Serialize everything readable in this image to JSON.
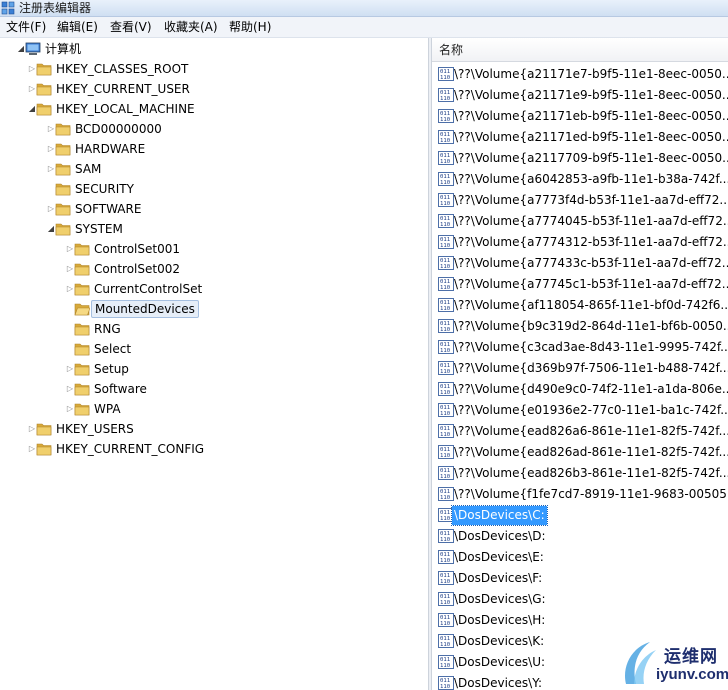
{
  "window": {
    "title": "注册表编辑器"
  },
  "menu": {
    "file": "文件(F)",
    "edit": "编辑(E)",
    "view": "查看(V)",
    "favorites": "收藏夹(A)",
    "help": "帮助(H)"
  },
  "tree": [
    {
      "label": "计算机",
      "level": 0,
      "state": "expanded",
      "icon": "computer-icon"
    },
    {
      "label": "HKEY_CLASSES_ROOT",
      "level": 1,
      "state": "collapsed",
      "icon": "folder-icon"
    },
    {
      "label": "HKEY_CURRENT_USER",
      "level": 1,
      "state": "collapsed",
      "icon": "folder-icon"
    },
    {
      "label": "HKEY_LOCAL_MACHINE",
      "level": 1,
      "state": "expanded",
      "icon": "folder-icon"
    },
    {
      "label": "BCD00000000",
      "level": 2,
      "state": "collapsed",
      "icon": "folder-icon"
    },
    {
      "label": "HARDWARE",
      "level": 2,
      "state": "collapsed",
      "icon": "folder-icon"
    },
    {
      "label": "SAM",
      "level": 2,
      "state": "collapsed",
      "icon": "folder-icon"
    },
    {
      "label": "SECURITY",
      "level": 2,
      "state": "leaf",
      "icon": "folder-icon"
    },
    {
      "label": "SOFTWARE",
      "level": 2,
      "state": "collapsed",
      "icon": "folder-icon"
    },
    {
      "label": "SYSTEM",
      "level": 2,
      "state": "expanded",
      "icon": "folder-icon"
    },
    {
      "label": "ControlSet001",
      "level": 3,
      "state": "collapsed",
      "icon": "folder-icon"
    },
    {
      "label": "ControlSet002",
      "level": 3,
      "state": "collapsed",
      "icon": "folder-icon"
    },
    {
      "label": "CurrentControlSet",
      "level": 3,
      "state": "collapsed",
      "icon": "folder-icon"
    },
    {
      "label": "MountedDevices",
      "level": 3,
      "state": "leaf",
      "icon": "folder-open-icon",
      "selected": true
    },
    {
      "label": "RNG",
      "level": 3,
      "state": "leaf",
      "icon": "folder-icon"
    },
    {
      "label": "Select",
      "level": 3,
      "state": "leaf",
      "icon": "folder-icon"
    },
    {
      "label": "Setup",
      "level": 3,
      "state": "collapsed",
      "icon": "folder-icon"
    },
    {
      "label": "Software",
      "level": 3,
      "state": "collapsed",
      "icon": "folder-icon"
    },
    {
      "label": "WPA",
      "level": 3,
      "state": "collapsed",
      "icon": "folder-icon"
    },
    {
      "label": "HKEY_USERS",
      "level": 1,
      "state": "collapsed",
      "icon": "folder-icon"
    },
    {
      "label": "HKEY_CURRENT_CONFIG",
      "level": 1,
      "state": "collapsed",
      "icon": "folder-icon"
    }
  ],
  "list": {
    "column_name": "名称",
    "values": [
      {
        "name": "\\??\\Volume{a21171e7-b9f5-11e1-8eec-0050..."
      },
      {
        "name": "\\??\\Volume{a21171e9-b9f5-11e1-8eec-0050..."
      },
      {
        "name": "\\??\\Volume{a21171eb-b9f5-11e1-8eec-0050..."
      },
      {
        "name": "\\??\\Volume{a21171ed-b9f5-11e1-8eec-0050..."
      },
      {
        "name": "\\??\\Volume{a2117709-b9f5-11e1-8eec-0050..."
      },
      {
        "name": "\\??\\Volume{a6042853-a9fb-11e1-b38a-742f..."
      },
      {
        "name": "\\??\\Volume{a7773f4d-b53f-11e1-aa7d-eff72..."
      },
      {
        "name": "\\??\\Volume{a7774045-b53f-11e1-aa7d-eff72..."
      },
      {
        "name": "\\??\\Volume{a7774312-b53f-11e1-aa7d-eff72..."
      },
      {
        "name": "\\??\\Volume{a777433c-b53f-11e1-aa7d-eff72..."
      },
      {
        "name": "\\??\\Volume{a77745c1-b53f-11e1-aa7d-eff72..."
      },
      {
        "name": "\\??\\Volume{af118054-865f-11e1-bf0d-742f6..."
      },
      {
        "name": "\\??\\Volume{b9c319d2-864d-11e1-bf6b-0050..."
      },
      {
        "name": "\\??\\Volume{c3cad3ae-8d43-11e1-9995-742f..."
      },
      {
        "name": "\\??\\Volume{d369b97f-7506-11e1-b488-742f..."
      },
      {
        "name": "\\??\\Volume{d490e9c0-74f2-11e1-a1da-806e..."
      },
      {
        "name": "\\??\\Volume{e01936e2-77c0-11e1-ba1c-742f..."
      },
      {
        "name": "\\??\\Volume{ead826a6-861e-11e1-82f5-742f..."
      },
      {
        "name": "\\??\\Volume{ead826ad-861e-11e1-82f5-742f..."
      },
      {
        "name": "\\??\\Volume{ead826b3-861e-11e1-82f5-742f..."
      },
      {
        "name": "\\??\\Volume{f1fe7cd7-8919-11e1-9683-00505..."
      },
      {
        "name": "\\DosDevices\\C:",
        "selected": true
      },
      {
        "name": "\\DosDevices\\D:"
      },
      {
        "name": "\\DosDevices\\E:"
      },
      {
        "name": "\\DosDevices\\F:"
      },
      {
        "name": "\\DosDevices\\G:"
      },
      {
        "name": "\\DosDevices\\H:"
      },
      {
        "name": "\\DosDevices\\K:"
      },
      {
        "name": "\\DosDevices\\U:"
      },
      {
        "name": "\\DosDevices\\Y:"
      }
    ]
  },
  "watermark": {
    "cn": "运维网",
    "en": "iyunv.com"
  },
  "colors": {
    "selection": "#3399ff",
    "tree_selection_bg": "#e6eef8",
    "folder": "#e8c25c"
  }
}
